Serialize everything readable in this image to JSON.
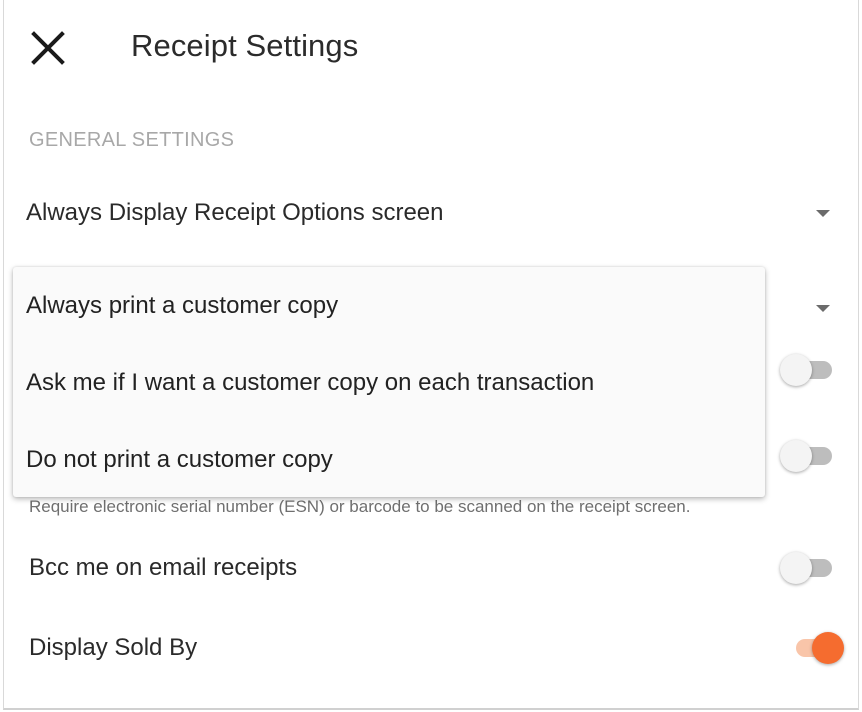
{
  "header": {
    "title": "Receipt Settings",
    "close_icon": "close-icon"
  },
  "general_settings": {
    "section_title": "GENERAL SETTINGS",
    "receipt_options": {
      "label": "Always Display Receipt Options screen",
      "icon": "caret-down-icon"
    },
    "customer_copy": {
      "icon": "caret-down-icon",
      "menu_options": [
        "Always print a customer copy",
        "Ask me if I want a customer copy on each transaction",
        "Do not print a customer copy"
      ]
    },
    "hidden_toggle_1": {
      "enabled": false
    },
    "require_esn": {
      "enabled": false,
      "hint": "Require electronic serial number (ESN) or barcode to be scanned on the receipt screen."
    },
    "bcc_email": {
      "label": "Bcc me on email receipts",
      "enabled": false
    },
    "display_sold_by": {
      "label": "Display Sold By",
      "enabled": true
    }
  },
  "colors": {
    "accent": "#f56c2f",
    "accent_track": "#f9c5a9",
    "section_header": "#a8a8a8"
  }
}
